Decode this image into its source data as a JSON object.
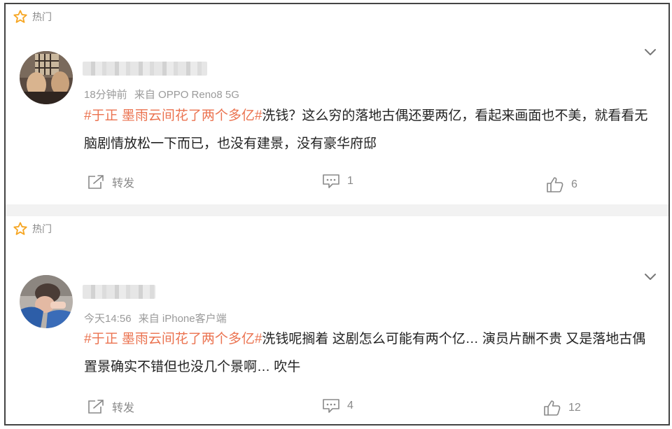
{
  "colors": {
    "accent": "#eb7350",
    "star": "#f6a623",
    "muted": "#8a8a8a"
  },
  "posts": [
    {
      "hot_label": "热门",
      "time": "18分钟前",
      "source": "来自 OPPO Reno8 5G",
      "hashtag": "#于正 墨雨云间花了两个多亿#",
      "text": "洗钱？这么穷的落地古偶还要两亿，看起来画面也不美，就看看无脑剧情放松一下而已，也没有建景，没有豪华府邸",
      "repost_label": "转发",
      "comments": "1",
      "likes": "6"
    },
    {
      "hot_label": "热门",
      "time": "今天14:56",
      "source": "来自 iPhone客户端",
      "hashtag": "#于正 墨雨云间花了两个多亿#",
      "text": "洗钱呢搁着 这剧怎么可能有两个亿… 演员片酬不贵 又是落地古偶 置景确实不错但也没几个景啊… 吹牛",
      "repost_label": "转发",
      "comments": "4",
      "likes": "12"
    }
  ]
}
